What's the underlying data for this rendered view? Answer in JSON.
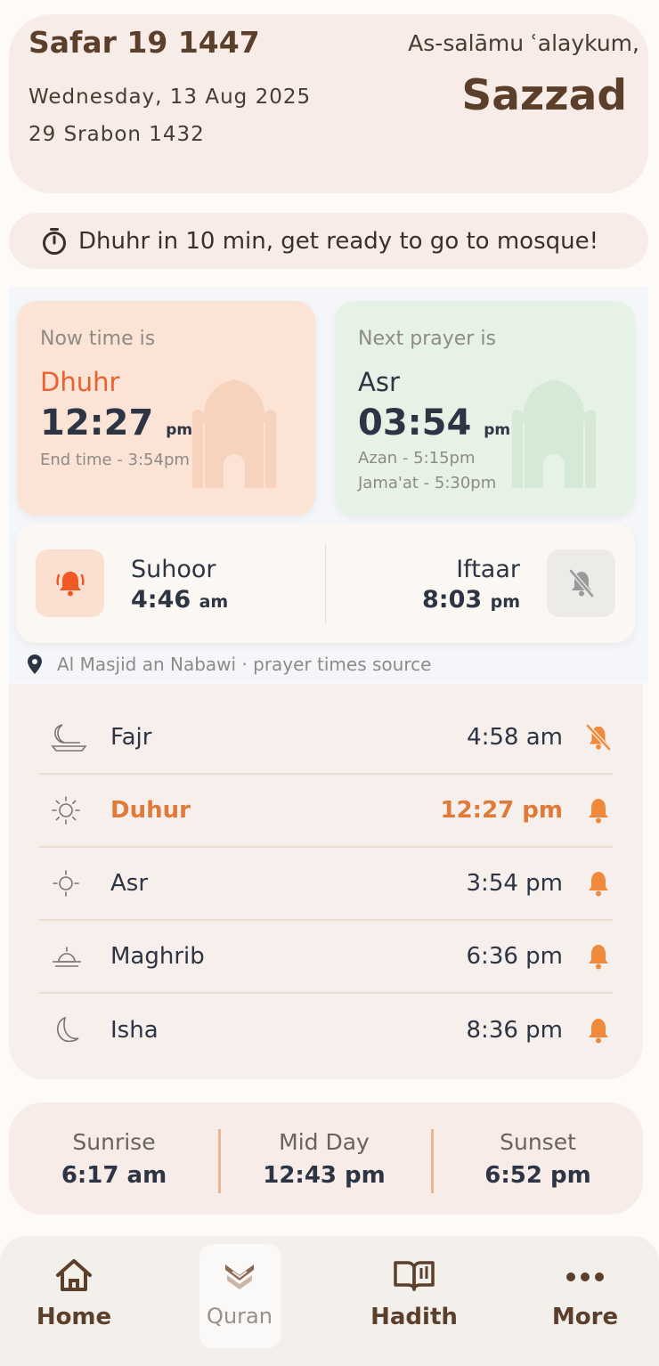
{
  "header": {
    "hijri_date": "Safar 19 1447",
    "gregorian_date": "Wednesday, 13 Aug 2025",
    "bangla_date": "29 Srabon 1432",
    "greeting": "As-salāmu ʿalaykum,",
    "user_name": "Sazzad"
  },
  "reminder": {
    "icon": "stopwatch-icon",
    "text": "Dhuhr in 10 min, get ready to go to mosque!"
  },
  "now_card": {
    "label": "Now time is",
    "prayer": "Dhuhr",
    "time": "12:27",
    "ampm": "pm",
    "end_time": "End time - 3:54pm",
    "accent": "#e9622f"
  },
  "next_card": {
    "label": "Next prayer is",
    "prayer": "Asr",
    "time": "03:54",
    "ampm": "pm",
    "azan": "Azan - 5:15pm",
    "jamaat": "Jama'at - 5:30pm"
  },
  "suhoor": {
    "label": "Suhoor",
    "time": "4:46",
    "ampm": "am",
    "alarm": "on"
  },
  "iftaar": {
    "label": "Iftaar",
    "time": "8:03",
    "ampm": "pm",
    "alarm": "off"
  },
  "source": "Al Masjid an Nabawi · prayer times source",
  "prayers": [
    {
      "name": "Fajr",
      "time": "4:58 am",
      "icon": "crescent-boat-icon",
      "alarm": "off"
    },
    {
      "name": "Duhur",
      "time": "12:27 pm",
      "icon": "sun-icon",
      "alarm": "on",
      "active": true
    },
    {
      "name": "Asr",
      "time": "3:54 pm",
      "icon": "small-sun-icon",
      "alarm": "on"
    },
    {
      "name": "Maghrib",
      "time": "6:36 pm",
      "icon": "sunset-icon",
      "alarm": "on"
    },
    {
      "name": "Isha",
      "time": "8:36 pm",
      "icon": "moon-icon",
      "alarm": "on"
    }
  ],
  "sun_times": [
    {
      "label": "Sunrise",
      "value": "6:17 am"
    },
    {
      "label": "Mid Day",
      "value": "12:43 pm"
    },
    {
      "label": "Sunset",
      "value": "6:52 pm"
    }
  ],
  "nav": [
    {
      "label": "Home",
      "icon": "home-icon"
    },
    {
      "label": "Quran",
      "icon": "quran-icon",
      "selected": true
    },
    {
      "label": "Hadith",
      "icon": "book-icon"
    },
    {
      "label": "More",
      "icon": "more-dots-icon"
    }
  ],
  "colors": {
    "accent_orange": "#e9622f",
    "brown": "#5b3f2a",
    "bell_orange": "#ef8a3c"
  }
}
